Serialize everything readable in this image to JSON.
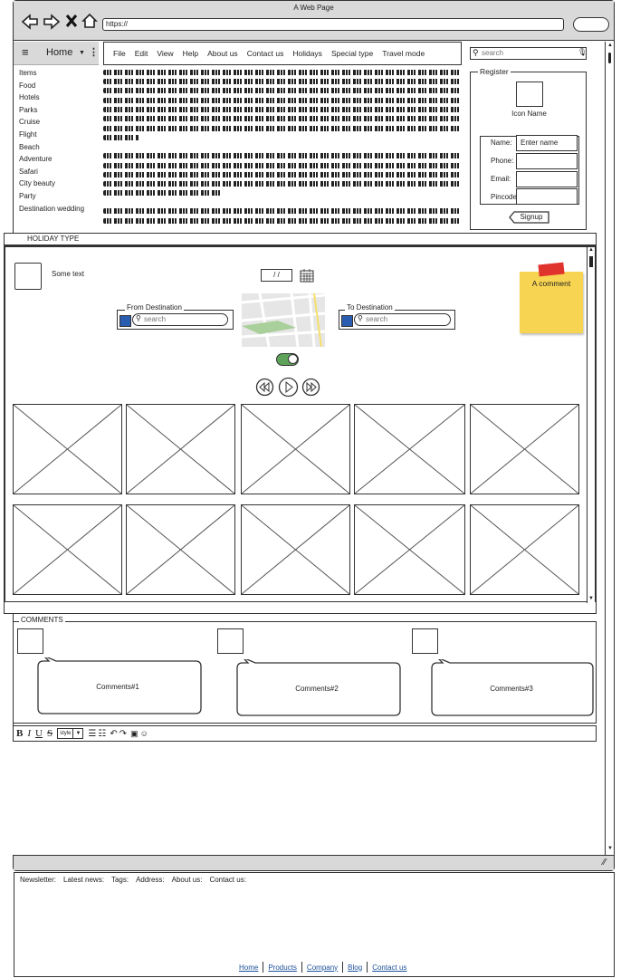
{
  "window": {
    "title": "A Web Page",
    "url": "https://"
  },
  "sidebar": {
    "home_label": "Home",
    "items": [
      "Items",
      "Food",
      "Hotels",
      "Parks",
      "Cruise",
      "Flight",
      "Beach",
      "Adventure",
      "Safari",
      "City beauty",
      "Party",
      "Destination wedding"
    ]
  },
  "menu": [
    "File",
    "Edit",
    "View",
    "Help",
    "About us",
    "Contact us",
    "Holidays",
    "Special type",
    "Travel mode"
  ],
  "search": {
    "placeholder": "search"
  },
  "register": {
    "title": "Register",
    "icon_label": "Icon Name",
    "fields": [
      {
        "label": "Name:",
        "value": "Enter name"
      },
      {
        "label": "Phone:",
        "value": ""
      },
      {
        "label": "Email:",
        "value": ""
      },
      {
        "label": "Pincode:",
        "value": ""
      }
    ],
    "signup_label": "Signup"
  },
  "holiday": {
    "title": "HOLIDAY TYPE",
    "some_text": "Some text",
    "date_value": "/  /",
    "from_label": "From Destination",
    "to_label": "To Destination",
    "search_placeholder": "search",
    "comment_note": "A comment",
    "toggle_on": true
  },
  "comments": {
    "title": "COMMENTS",
    "items": [
      "Comments#1",
      "Comments#2",
      "Comments#3"
    ]
  },
  "editor": {
    "style_label": "style"
  },
  "footer": {
    "info": [
      "Newsletter:",
      "Latest news:",
      "Tags:",
      "Address:",
      "About us:",
      "Contact us:"
    ],
    "links": [
      "Home",
      "Products",
      "Company",
      "Blog",
      "Contact us"
    ]
  }
}
